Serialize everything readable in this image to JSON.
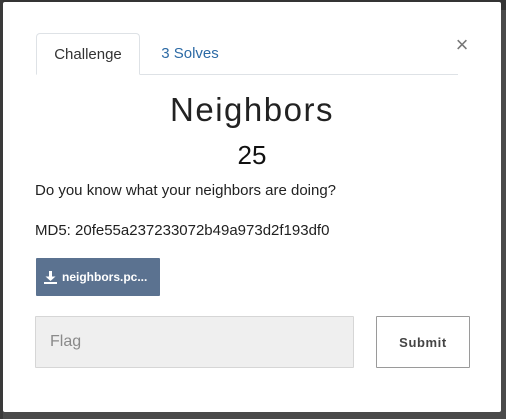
{
  "tabs": [
    {
      "label": "Challenge",
      "active": true
    },
    {
      "label": "3 Solves",
      "active": false
    }
  ],
  "close_glyph": "×",
  "challenge": {
    "name": "Neighbors",
    "value": "25",
    "description": "Do you know what your neighbors are doing?",
    "md5_line": "MD5: 20fe55a237233072b49a973d2f193df0"
  },
  "file": {
    "label": "neighbors.pc...",
    "icon": "download-icon"
  },
  "flag": {
    "placeholder": "Flag",
    "value": ""
  },
  "submit": {
    "label": "Submit"
  },
  "colors": {
    "file_button": "#5b7290",
    "tab_link": "#2c6aa5",
    "input_bg": "#efefef",
    "backdrop": "#4a4a4a"
  }
}
